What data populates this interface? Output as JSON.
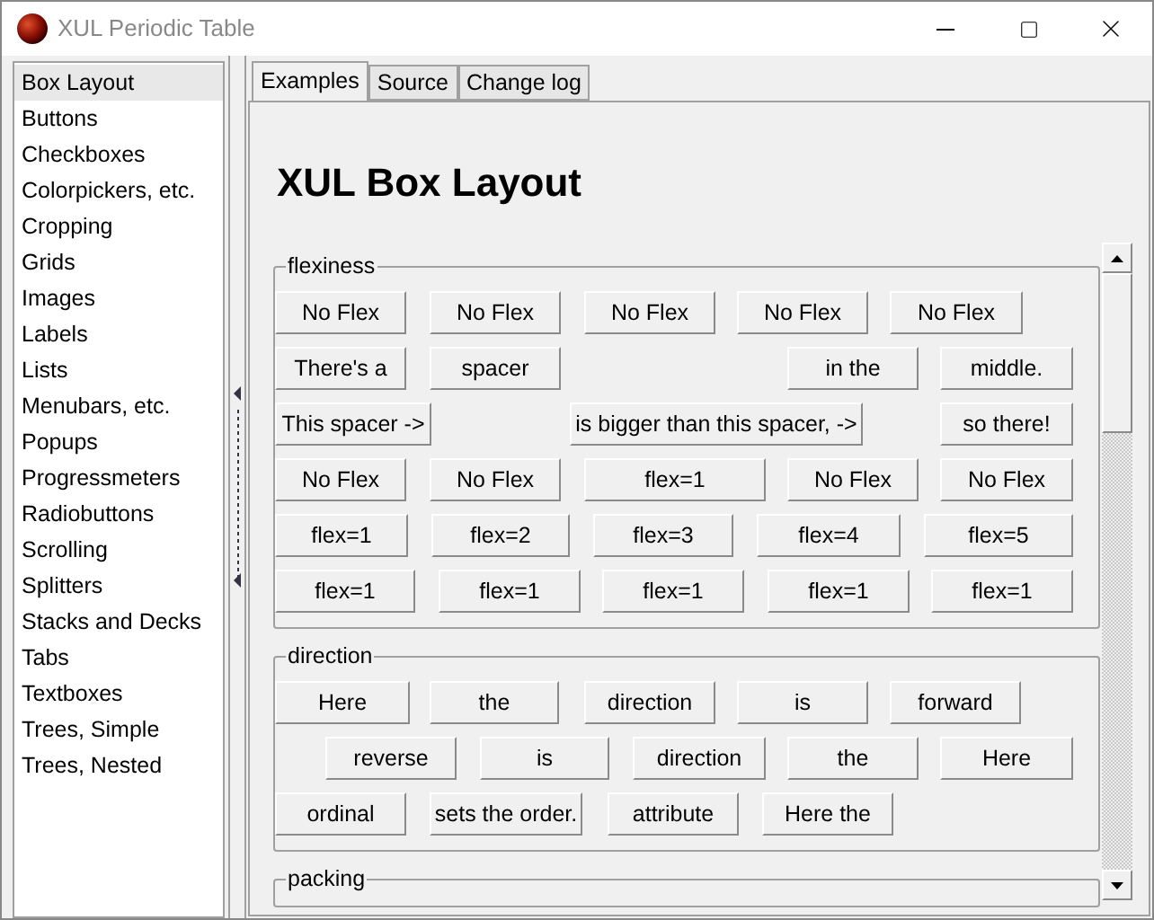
{
  "window": {
    "title": "XUL Periodic Table"
  },
  "sidebar": {
    "items": [
      {
        "label": "Box Layout",
        "selected": true
      },
      {
        "label": "Buttons",
        "selected": false
      },
      {
        "label": "Checkboxes",
        "selected": false
      },
      {
        "label": "Colorpickers, etc.",
        "selected": false
      },
      {
        "label": "Cropping",
        "selected": false
      },
      {
        "label": "Grids",
        "selected": false
      },
      {
        "label": "Images",
        "selected": false
      },
      {
        "label": "Labels",
        "selected": false
      },
      {
        "label": "Lists",
        "selected": false
      },
      {
        "label": "Menubars, etc.",
        "selected": false
      },
      {
        "label": "Popups",
        "selected": false
      },
      {
        "label": "Progressmeters",
        "selected": false
      },
      {
        "label": "Radiobuttons",
        "selected": false
      },
      {
        "label": "Scrolling",
        "selected": false
      },
      {
        "label": "Splitters",
        "selected": false
      },
      {
        "label": "Stacks and Decks",
        "selected": false
      },
      {
        "label": "Tabs",
        "selected": false
      },
      {
        "label": "Textboxes",
        "selected": false
      },
      {
        "label": "Trees, Simple",
        "selected": false
      },
      {
        "label": "Trees, Nested",
        "selected": false
      }
    ]
  },
  "tabs": [
    {
      "label": "Examples",
      "selected": true
    },
    {
      "label": "Source",
      "selected": false
    },
    {
      "label": "Change log",
      "selected": false
    }
  ],
  "heading": "XUL Box Layout",
  "fieldsets": [
    {
      "legend": "flexiness",
      "rows": [
        {
          "buttons": [
            "No Flex",
            "No Flex",
            "No Flex",
            "No Flex",
            "No Flex"
          ]
        },
        {
          "buttons": [
            "There's a",
            "spacer",
            "in the",
            "middle."
          ]
        },
        {
          "buttons": [
            "This spacer ->",
            "is bigger than this spacer, ->",
            "so there!"
          ]
        },
        {
          "buttons": [
            "No Flex",
            "No Flex",
            "flex=1",
            "No Flex",
            "No Flex"
          ]
        },
        {
          "buttons": [
            "flex=1",
            "flex=2",
            "flex=3",
            "flex=4",
            "flex=5"
          ]
        },
        {
          "buttons": [
            "flex=1",
            "flex=1",
            "flex=1",
            "flex=1",
            "flex=1"
          ]
        }
      ]
    },
    {
      "legend": "direction",
      "rows": [
        {
          "buttons": [
            "Here",
            "the",
            "direction",
            "is",
            "forward"
          ]
        },
        {
          "buttons": [
            "reverse",
            "is",
            "direction",
            "the",
            "Here"
          ]
        },
        {
          "buttons": [
            "ordinal",
            "sets the order.",
            "attribute",
            "Here the"
          ]
        }
      ]
    },
    {
      "legend": "packing"
    }
  ]
}
